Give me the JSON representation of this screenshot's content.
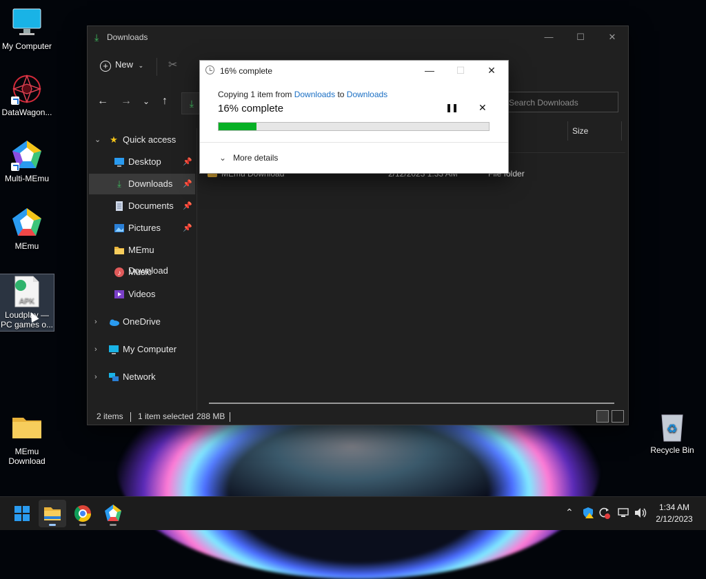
{
  "desktop": {
    "icons": [
      {
        "label": "My Computer"
      },
      {
        "label": "DataWagon..."
      },
      {
        "label": "Multi-MEmu"
      },
      {
        "label": "MEmu"
      },
      {
        "label": "Loudplay —\nPC games o...",
        "line1": "Loudplay —",
        "line2": "PC games o...",
        "badge": "APK"
      },
      {
        "label": "MEmu Download",
        "line1": "MEmu",
        "line2": "Download"
      },
      {
        "label": "Recycle Bin"
      }
    ]
  },
  "explorer": {
    "title": "Downloads",
    "toolbar": {
      "new_label": "New"
    },
    "search_placeholder": "Search Downloads",
    "sidebar": {
      "quick_access": "Quick access",
      "items": [
        {
          "label": "Desktop"
        },
        {
          "label": "Downloads"
        },
        {
          "label": "Documents"
        },
        {
          "label": "Pictures"
        },
        {
          "label": "MEmu Download"
        },
        {
          "label": "Music"
        },
        {
          "label": "Videos"
        }
      ],
      "onedrive": "OneDrive",
      "my_computer": "My Computer",
      "network": "Network"
    },
    "columns": {
      "size": "Size"
    },
    "rows": [
      {
        "name": "MEmu Download",
        "date": "2/12/2023 1:33 AM",
        "type": "File folder"
      }
    ],
    "status": {
      "items": "2 items",
      "selected": "1 item selected",
      "size": "288 MB"
    }
  },
  "copy_dialog": {
    "title": "16% complete",
    "copy_prefix": "Copying 1 item from",
    "from": "Downloads",
    "to_word": "to",
    "to": "Downloads",
    "percent_text": "16% complete",
    "progress": 0.14,
    "more_details": "More details"
  },
  "taskbar": {
    "time": "1:34 AM",
    "date": "2/12/2023"
  },
  "colors": {
    "progress": "#06b025",
    "link": "#1a6fc4",
    "accent_green": "#3fbf60"
  }
}
